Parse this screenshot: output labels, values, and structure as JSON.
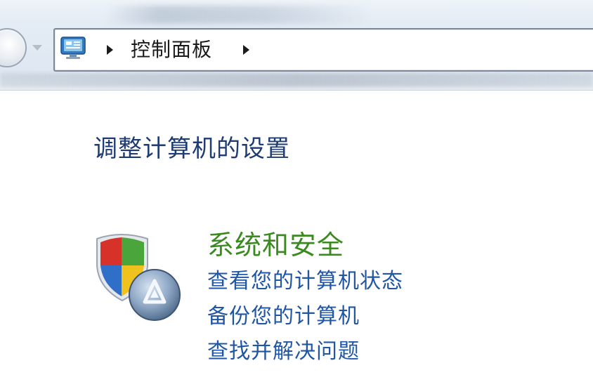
{
  "address_bar": {
    "crumbs": [
      "控制面板"
    ],
    "icon": "control-panel-icon"
  },
  "page": {
    "title": "调整计算机的设置"
  },
  "categories": [
    {
      "icon": "security-shield-icon",
      "title": "系统和安全",
      "links": [
        "查看您的计算机状态",
        "备份您的计算机",
        "查找并解决问题"
      ]
    }
  ],
  "colors": {
    "title": "#1e3b73",
    "category_title": "#3a8a1f",
    "link": "#2156a5"
  }
}
